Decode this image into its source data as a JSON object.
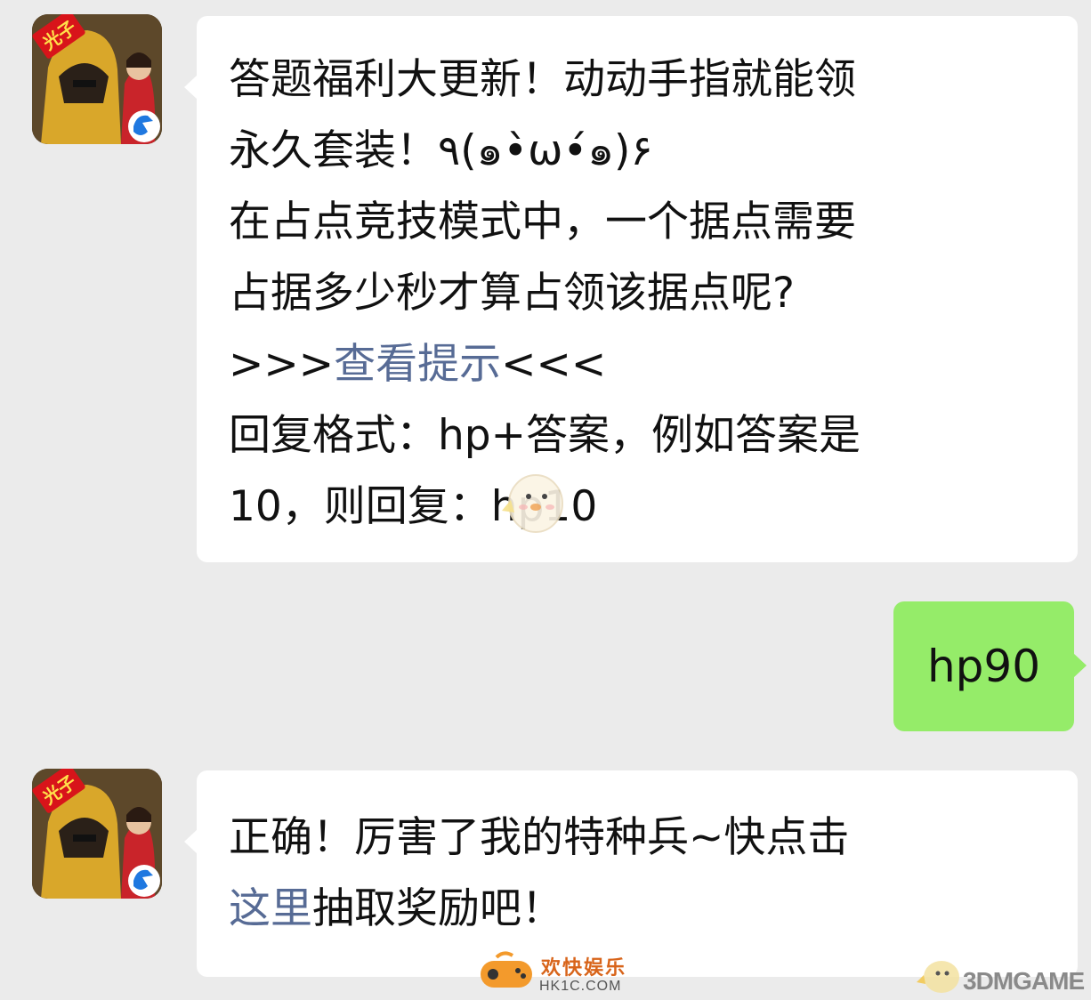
{
  "messages": {
    "first": {
      "avatar_badge": "光子",
      "lines": [
        "答题福利大更新！动动手指就能领",
        "永久套装！٩(๑•̀ω•́๑)۶",
        "在占点竞技模式中，一个据点需要",
        "占据多少秒才算占领该据点呢?"
      ],
      "hint_prefix": ">>>",
      "hint_link": "查看提示",
      "hint_suffix": "<<<",
      "reply_lines": [
        "回复格式：hp+答案，例如答案是",
        "10，则回复：hp10"
      ]
    },
    "mine": {
      "text": "hp90"
    },
    "second": {
      "avatar_badge": "光子",
      "line1": "正确！厉害了我的特种兵~快点击",
      "link": "这里",
      "line2_rest": "抽取奖励吧！"
    }
  },
  "watermarks": {
    "hk1c_cn": "欢快娱乐",
    "hk1c_url": "HK1C.COM",
    "threedm": "3DMGAME"
  },
  "colors": {
    "background": "#ebebeb",
    "bubble": "#ffffff",
    "my_bubble": "#95ec69",
    "link": "#576b95"
  }
}
